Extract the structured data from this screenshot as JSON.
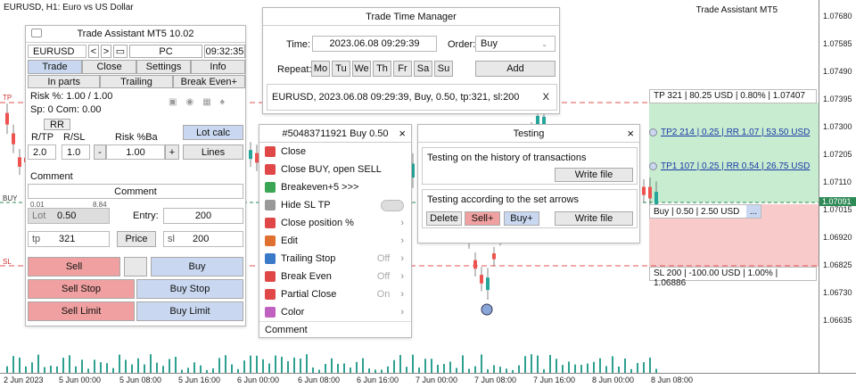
{
  "chart": {
    "symbol": "EURUSD, H1:  Euro vs US Dollar",
    "brand": "Trade Assistant MT5",
    "yticks": [
      "1.07680",
      "1.07585",
      "1.07490",
      "1.07395",
      "1.07300",
      "1.07205",
      "1.07110",
      "1.07015",
      "1.06920",
      "1.06825",
      "1.06730",
      "1.06635"
    ],
    "current_price": "1.07091",
    "xticks": [
      "2 Jun 2023",
      "5 Jun 00:00",
      "5 Jun 08:00",
      "5 Jun 16:00",
      "6 Jun 00:00",
      "6 Jun 08:00",
      "6 Jun 16:00",
      "7 Jun 00:00",
      "7 Jun 08:00",
      "7 Jun 16:00",
      "8 Jun 00:00",
      "8 Jun 08:00"
    ],
    "labels": {
      "tp": "TP",
      "buy": "BUY",
      "sl": "SL"
    },
    "tp_box": "TP 321 | 80.25 USD | 0.80% | 1.07407",
    "tp2": "TP2 214 | 0.25 | RR 1.07 | 53.50 USD",
    "tp1": "TP1 107 | 0.25 | RR 0.54 | 26.75 USD",
    "buy_box": "Buy | 0.50 | 2.50 USD",
    "buy_box_btn": "...",
    "sl_box": "SL 200 | -100.00 USD | 1.00% | 1.06886",
    "colors": {
      "up": "#26a69a",
      "down": "#ef5350",
      "tp_zone": "#c8ecd0",
      "sl_zone": "#f8caca"
    }
  },
  "ta": {
    "title": "Trade Assistant MT5 10.02",
    "symbol": "EURUSD",
    "nav_prev": "<",
    "nav_next": ">",
    "mode": "PC",
    "time": "09:32:35",
    "tabs": [
      "Trade",
      "Close",
      "Settings",
      "Info"
    ],
    "subtabs": [
      "In parts",
      "Trailing",
      "Break Even+"
    ],
    "risk": "Risk %: 1.00 /  1.00",
    "spread": "Sp: 0  Com: 0.00",
    "rr": "RR",
    "rtp_label": "R/TP",
    "rsl_label": "R/SL",
    "riskba_label": "Risk %Ba",
    "rtp": "2.0",
    "rsl": "1.0",
    "riskba": "1.00",
    "minus": "-",
    "plus": "+",
    "lotcalc": "Lot calc",
    "lines": "Lines",
    "comment_label": "Comment",
    "comment_value": "Comment",
    "lot_min": "0.01",
    "lot_max": "8.84",
    "lot_label": "Lot",
    "lot": "0.50",
    "entry_label": "Entry:",
    "entry": "200",
    "tp_label": "tp",
    "tp": "321",
    "price": "Price",
    "sl_label": "sl",
    "sl": "200",
    "sell": "Sell",
    "buy": "Buy",
    "sellstop": "Sell Stop",
    "buystop": "Buy Stop",
    "selllimit": "Sell Limit",
    "buylimit": "Buy Limit"
  },
  "ttm": {
    "title": "Trade Time Manager",
    "time_label": "Time:",
    "time": "2023.06.08 09:29:39",
    "order_label": "Order:",
    "order": "Buy",
    "repeat_label": "Repeat:",
    "days": [
      "Mo",
      "Tu",
      "We",
      "Th",
      "Fr",
      "Sa",
      "Su"
    ],
    "add": "Add",
    "entry": "EURUSD, 2023.06.08 09:29:39, Buy, 0.50, tp:321, sl:200",
    "close": "X"
  },
  "ctx": {
    "title": "#50483711921 Buy 0.50",
    "close": "×",
    "items": [
      {
        "label": "Close",
        "icon": "close-icon",
        "color": "#e04848"
      },
      {
        "label": "Close BUY, open SELL",
        "icon": "reverse-icon",
        "color": "#e04848"
      },
      {
        "label": "Breakeven+5 >>>",
        "icon": "shield-icon",
        "color": "#3aa655"
      },
      {
        "label": "Hide SL TP",
        "icon": "hide-icon",
        "color": "#999"
      },
      {
        "label": "Close position %",
        "icon": "percent-icon",
        "color": "#e04848"
      },
      {
        "label": "Edit",
        "icon": "edit-icon",
        "color": "#e07030"
      },
      {
        "label": "Trailing Stop",
        "icon": "trailing-icon",
        "color": "#3a78c8",
        "state": "Off"
      },
      {
        "label": "Break Even",
        "icon": "breakeven-icon",
        "color": "#e04848",
        "state": "Off"
      },
      {
        "label": "Partial Close",
        "icon": "partial-icon",
        "color": "#e04848",
        "state": "On"
      },
      {
        "label": "Color",
        "icon": "color-icon",
        "color": "#c060c0"
      }
    ],
    "comment": "Comment"
  },
  "test": {
    "title": "Testing",
    "close": "×",
    "hist": "Testing on the history of transactions",
    "write1": "Write file",
    "arrows": "Testing according to the set arrows",
    "delete": "Delete",
    "sellp": "Sell+",
    "buyp": "Buy+",
    "write2": "Write file"
  }
}
